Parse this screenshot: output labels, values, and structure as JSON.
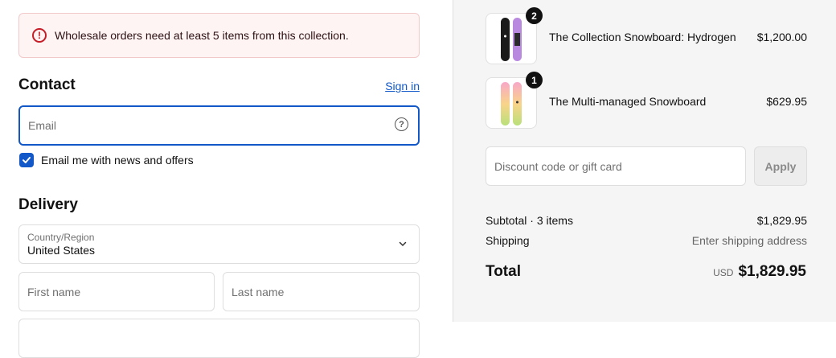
{
  "alert": {
    "message": "Wholesale orders need at least 5 items from this collection."
  },
  "contact": {
    "title": "Contact",
    "sign_in": "Sign in",
    "email_placeholder": "Email",
    "newsletter_label": "Email me with news and offers",
    "newsletter_checked": true
  },
  "delivery": {
    "title": "Delivery",
    "country_label": "Country/Region",
    "country_value": "United States",
    "first_name_placeholder": "First name",
    "last_name_placeholder": "Last name"
  },
  "cart": {
    "items": [
      {
        "name": "The Collection Snowboard: Hydrogen",
        "price": "$1,200.00",
        "quantity": "2"
      },
      {
        "name": "The Multi-managed Snowboard",
        "price": "$629.95",
        "quantity": "1"
      }
    ],
    "discount_placeholder": "Discount code or gift card",
    "apply_label": "Apply"
  },
  "summary": {
    "subtotal_label": "Subtotal · 3 items",
    "subtotal_value": "$1,829.95",
    "shipping_label": "Shipping",
    "shipping_value": "Enter shipping address",
    "total_label": "Total",
    "currency": "USD",
    "total_value": "$1,829.95"
  },
  "colors": {
    "accent": "#1258c8",
    "error": "#c51d27",
    "panel": "#f5f5f5"
  }
}
